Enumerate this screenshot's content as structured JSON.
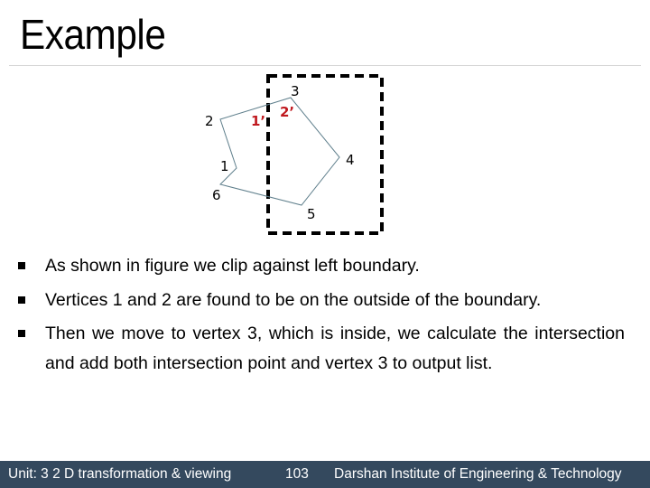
{
  "slide": {
    "title": "Example"
  },
  "figure": {
    "vertex_labels": {
      "v1": "1",
      "v2": "2",
      "v3": "3",
      "v4": "4",
      "v5": "5",
      "v6": "6"
    },
    "intersection_labels": {
      "i1": "1’",
      "i2": "2’"
    },
    "colors": {
      "polygon": "#5f7f8c",
      "clip_window": "#000000",
      "intersection_label": "#c0191f"
    }
  },
  "bullets": [
    {
      "text": "As shown in figure we clip against left boundary."
    },
    {
      "text": "Vertices 1 and 2 are found to be on the outside of the boundary."
    },
    {
      "text": "Then we move to vertex 3, which is inside, we calculate the intersection and add both intersection point and vertex 3 to output list."
    }
  ],
  "footer": {
    "unit": "Unit: 3 2 D transformation & viewing",
    "page": "103",
    "institute": "Darshan Institute of Engineering & Technology",
    "background": "#34495e"
  }
}
